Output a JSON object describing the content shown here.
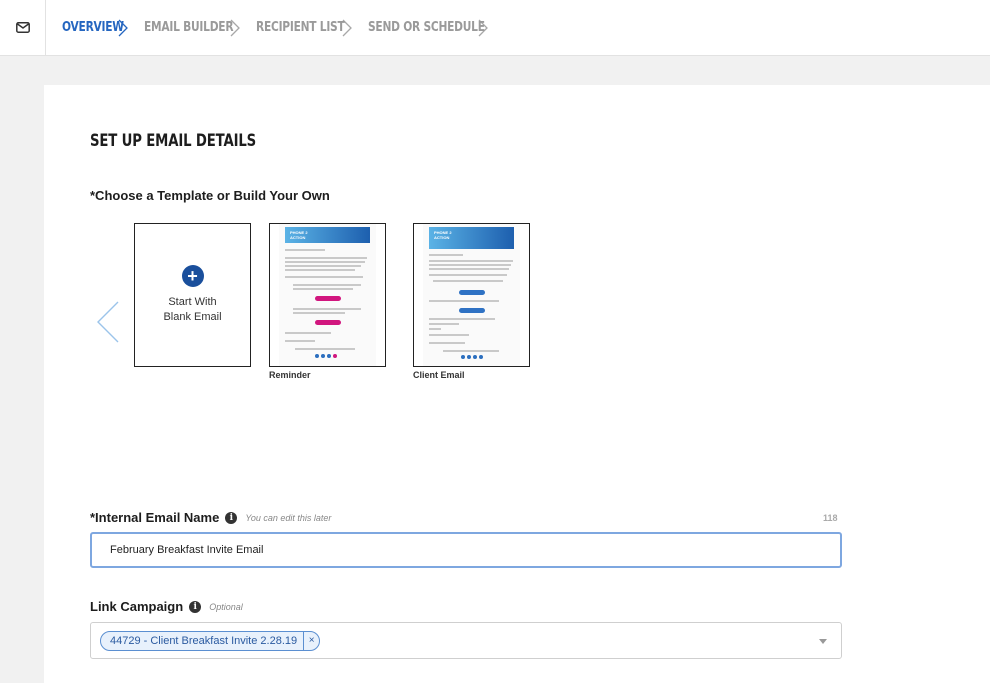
{
  "breadcrumb": {
    "steps": [
      {
        "label": "OVERVIEW",
        "active": true
      },
      {
        "label": "EMAIL BUILDER",
        "active": false
      },
      {
        "label": "RECIPIENT LIST",
        "active": false
      },
      {
        "label": "SEND OR SCHEDULE",
        "active": false
      }
    ]
  },
  "section": {
    "title": "SET UP EMAIL DETAILS",
    "template_label": "*Choose a Template or Build Your Own"
  },
  "templates": {
    "blank": {
      "line1": "Start With",
      "line2": "Blank Email"
    },
    "items": [
      {
        "caption": "Reminder",
        "brand": "PHONE 2\nACTION"
      },
      {
        "caption": "Client Email",
        "brand": "PHONE 2\nACTION"
      }
    ]
  },
  "fields": {
    "email_name": {
      "label": "*Internal Email Name",
      "hint": "You can edit this later",
      "counter": "118",
      "value": "February Breakfast Invite Email"
    },
    "campaign": {
      "label": "Link Campaign",
      "hint": "Optional",
      "tag": "44729 - Client Breakfast Invite 2.28.19",
      "remove": "×"
    }
  },
  "colors": {
    "accent": "#2566c0",
    "inactive_step": "#9a9a9a",
    "pill_pink": "#d1167e",
    "pill_blue": "#2f72c4"
  },
  "icons": {
    "mail": "mail-icon",
    "chevron": "chevron-right-icon",
    "prev": "chevron-left-icon",
    "info": "info-icon",
    "plus": "plus-icon"
  }
}
